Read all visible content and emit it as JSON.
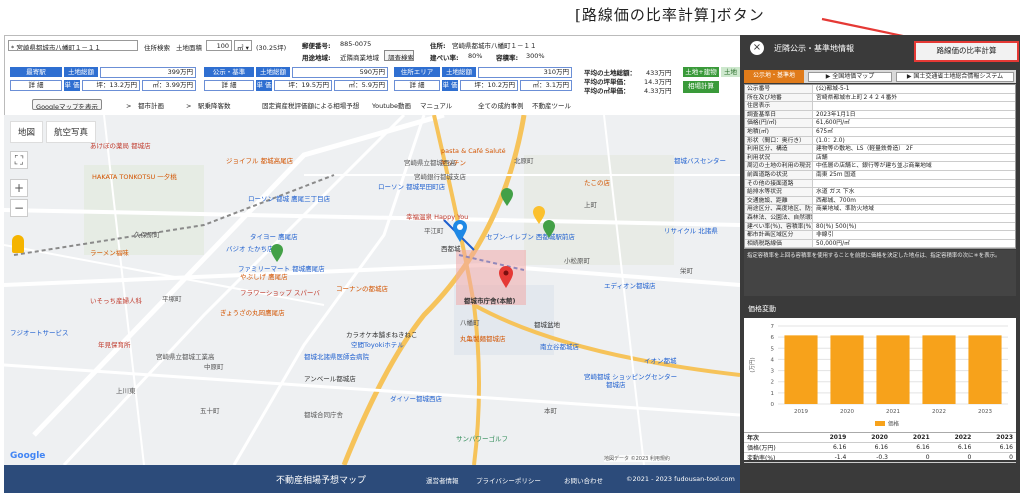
{
  "annotation": {
    "text": "[路線価の比率計算]ボタン"
  },
  "top": {
    "address_value": "* 宮崎県都城市八幡町１－１１",
    "search_label": "住所検索",
    "area_label": "土地面積",
    "area_value": "100",
    "unit_select": "㎡ ▾",
    "area_tsubo": "(30.25坪)",
    "postal_label": "郵便番号:",
    "postal_value": "885-0075",
    "youto_label": "用途地域:",
    "youto_value": "近隣商業地域",
    "survey_button": "調査検索",
    "address_label": "住所:",
    "address_right": "宮崎県都城市八幡町１－１１",
    "kenpei_label": "建ぺい率:",
    "kenpei_value": "80%",
    "yoseki_label": "容積率:",
    "yoseki_value": "300%"
  },
  "blocks": [
    {
      "title": "最寄駅",
      "sub": "土地総額",
      "amount": "399万円",
      "detail": "詳 細",
      "unit": "単 価",
      "tsubo": "坪：13.2万円",
      "sqm": "㎡：3.99万円"
    },
    {
      "title": "公示・基準",
      "sub": "土地総額",
      "amount": "590万円",
      "detail": "詳 細",
      "unit": "単 価",
      "tsubo": "坪：19.5万円",
      "sqm": "㎡：5.9万円"
    },
    {
      "title": "住所エリア",
      "sub": "土地総額",
      "amount": "310万円",
      "detail": "詳 細",
      "unit": "単 価",
      "tsubo": "坪：10.2万円",
      "sqm": "㎡：3.1万円"
    }
  ],
  "averages": {
    "l1": "平均の土地総額：",
    "v1": "433万円",
    "l2": "平均の坪単価：",
    "v2": "14.3万円",
    "l3": "平均の㎡単価：",
    "v3": "4.33万円"
  },
  "green": {
    "a": "土地+建物",
    "b": "土地",
    "calc": "相場計算"
  },
  "toolbar": {
    "google": "Googleマップを表示",
    "toshi": ">　都市計画",
    "eki": ">　駅乗降客数",
    "kotei": "固定資産税評価額による相場予想",
    "youtube": "Youtube動画",
    "manual": "マニュアル",
    "jirei": "全ての成約事例",
    "tool": "不動産ツール"
  },
  "map": {
    "tab_map": "地図",
    "tab_sat": "航空写真",
    "zoom_in": "+",
    "zoom_out": "−",
    "labels": [
      "あけぼの薬局 都城店",
      "ジョイフル 都城高尾店",
      "pasta & Café Saluté",
      "キッチン",
      "ローソン 都城 鷹尾三丁目店",
      "宮崎銀行都城支店",
      "ローソン 都城早田町店",
      "幸福温泉 Happy You",
      "セブン-イレブン 西都城駅前店",
      "西都城",
      "都城市庁舎(本館)",
      "丸亀製麺都城店",
      "コーナンの都城店",
      "ファミリーマート 都城鷹尾店",
      "タイヨー 鷹尾店",
      "バジオ たかち店",
      "やぶしげ 鷹尾店",
      "フラワーショップ スパーバ",
      "ぎょうざの丸岡鷹尾店",
      "いそっち産婦人科",
      "カラオケ本舗まねきねこ",
      "空間Toyokiホテル",
      "都城北諸県医師会病院",
      "アンベール都城店",
      "南立谷都城店",
      "ダイソー都城西店",
      "サンパワーゴルフ",
      "宮崎都城 ショッピングセンター",
      "イオン都城",
      "都城盆地",
      "HAKATA TONKOTSU 一夕桃",
      "久保原町",
      "平塚町",
      "上町",
      "中原町",
      "平江町",
      "北原町",
      "八幡町",
      "都城バスセンター",
      "ラーメン福味",
      "フジオートサービス",
      "年見保育所",
      "宮崎県立都城工業高",
      "五十町",
      "上川東",
      "小松原町",
      "本町",
      "栄町",
      "エディオン都城店",
      "宮崎県立都城西高",
      "都城店",
      "たこの店",
      "リサイクル 北諸県",
      "都城合同庁舎"
    ],
    "google_logo": "Google",
    "attribution": "地図データ ©2023 利用規約"
  },
  "footer": {
    "title": "不動産相場予想マップ",
    "link1": "運営者情報",
    "link2": "プライバシーポリシー",
    "link3": "お問い合わせ",
    "copyright": "©2021 - 2023 fudousan-tool.com"
  },
  "panel": {
    "close": "×",
    "title": "近隣公示・基準地情報",
    "ratio_button": "路線価の比率計算",
    "tab_left": "公示地・基準地",
    "map_button": "▶ 全国地価マップ",
    "system_button": "▶ 国土交通省土地総合情報システム",
    "rows": [
      {
        "k": "公示番号",
        "v": "(公)都城-5-1"
      },
      {
        "k": "所在及び地番",
        "v": "宮崎県都城市上町２４２４番外"
      },
      {
        "k": "住居表示",
        "v": ""
      },
      {
        "k": "調査基準日",
        "v": "2023年1月1日"
      },
      {
        "k": "価格(円/㎡)",
        "v": "61,600円/㎡"
      },
      {
        "k": "地積(㎡)",
        "v": "675㎡"
      },
      {
        "k": "形状（間口：奥行き）",
        "v": "(1.0：2.0)"
      },
      {
        "k": "利用区分、構造",
        "v": "建物等の敷地、LS（軽量鉄骨造） 2F"
      },
      {
        "k": "利用状況",
        "v": "店舗"
      },
      {
        "k": "周辺の土地の利用の現況",
        "v": "中低層の店舗と、銀行等が建ち並ぶ商業地域"
      },
      {
        "k": "前面道路の状況",
        "v": "南東 25m 国道"
      },
      {
        "k": "その他の接面道路",
        "v": ""
      },
      {
        "k": "給排水等状況",
        "v": "水道 ガス 下水"
      },
      {
        "k": "交通施設、距離",
        "v": "西都城、700m"
      },
      {
        "k": "用途区分、高度地区、防火・準防火",
        "v": "商業地域、準防火地域"
      },
      {
        "k": "森林法、公園法、自然環境等",
        "v": ""
      },
      {
        "k": "建ぺい率(%)、容積率(%)",
        "v": "80(%) 500(%)"
      },
      {
        "k": "都市計画区域区分",
        "v": "非線引"
      },
      {
        "k": "相続税路線価",
        "v": "50,000円/㎡"
      }
    ],
    "note": "指定容積率を上回る容積率を使用することを前提に価格を決定した地点は、指定容積率の次に＊を表示。",
    "chart_title": "価格変動",
    "table_head": [
      "年次",
      "2019",
      "2020",
      "2021",
      "2022",
      "2023"
    ],
    "table_price": [
      "価格(万円)",
      "6.16",
      "6.16",
      "6.16",
      "6.16",
      "6.16"
    ],
    "table_change": [
      "変動率(%)",
      "-1.4",
      "-0.3",
      "0",
      "0",
      "0"
    ]
  },
  "chart_data": {
    "type": "bar",
    "title": "",
    "categories": [
      "2019",
      "2020",
      "2021",
      "2022",
      "2023"
    ],
    "series": [
      {
        "name": "価格",
        "values": [
          6.16,
          6.16,
          6.16,
          6.16,
          6.16
        ]
      }
    ],
    "ylabel": "(万円)",
    "xlabel": "",
    "ylim": [
      0,
      7
    ],
    "yticks": [
      "0",
      "1",
      "2",
      "3",
      "4",
      "5",
      "6",
      "7"
    ],
    "legend": "bottom",
    "bar_color": "#f7a21b",
    "grid": true
  }
}
